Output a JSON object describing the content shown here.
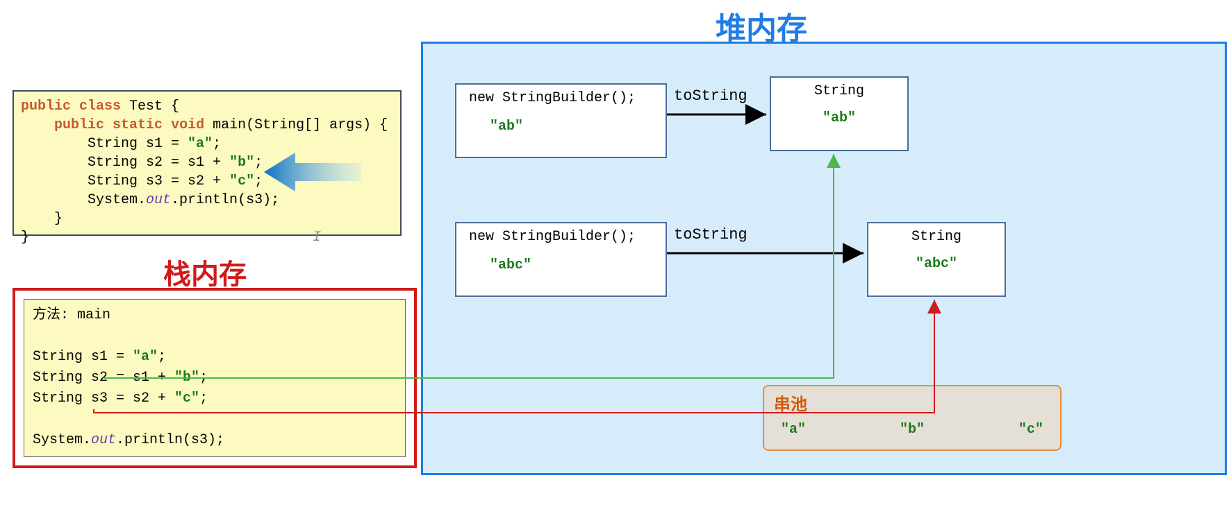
{
  "heap_title": "堆内存",
  "stack_title": "栈内存",
  "code": {
    "l1a": "public",
    "l1b": "class",
    "l1c": " Test {",
    "l2a": "public",
    "l2b": "static",
    "l2c": "void",
    "l2d": " main(String[] args) {",
    "l3a": "        String s1 = ",
    "l3b": "\"a\"",
    "l3c": ";",
    "l4a": "        String s2 = s1 + ",
    "l4b": "\"b\"",
    "l4c": ";",
    "l5a": "        String s3 = s2 + ",
    "l5b": "\"c\"",
    "l5c": ";",
    "l6a": "        System.",
    "l6b": "out",
    "l6c": ".println(s3);",
    "l7": "    }",
    "l8": "}",
    "cursor": "I"
  },
  "stack": {
    "method": "方法: main",
    "s1a": "String s1 = ",
    "s1b": "\"a\"",
    "s1c": ";",
    "s2a": "String s2 = s1 + ",
    "s2b": "\"b\"",
    "s2c": ";",
    "s3a": "String s3 = s2 + ",
    "s3b": "\"c\"",
    "s3c": ";",
    "p1": "System.",
    "p2": "out",
    "p3": ".println(s3);"
  },
  "heap": {
    "sb1_title": "new StringBuilder();",
    "sb1_val": "\"ab\"",
    "str1_title": "String",
    "str1_val": "\"ab\"",
    "ts1": "toString",
    "sb2_title": "new StringBuilder();",
    "sb2_val": "\"abc\"",
    "str2_title": "String",
    "str2_val": "\"abc\"",
    "ts2": "toString"
  },
  "pool": {
    "title": "串池",
    "a": "\"a\"",
    "b": "\"b\"",
    "c": "\"c\""
  }
}
